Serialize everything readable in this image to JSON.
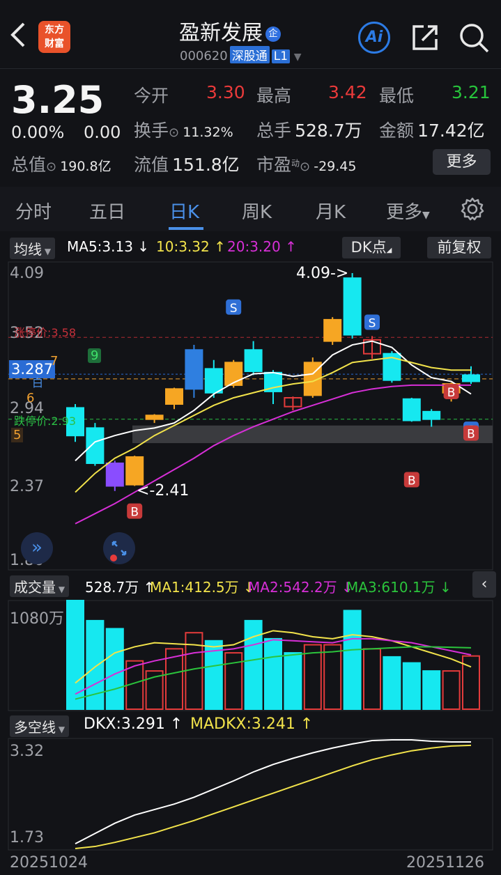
{
  "header": {
    "back_icon": "chevron-left-icon",
    "logo_line1": "东方",
    "logo_line2": "财富",
    "stock_name": "盈新发展",
    "company_badge": "企",
    "stock_code": "000620",
    "market_tag": "深股通",
    "level_tag": "L1",
    "ai_label": "Ai",
    "share_icon": "share-icon",
    "search_icon": "search-icon"
  },
  "quote": {
    "price": "3.25",
    "change_pct": "0.00%",
    "change": "0.00",
    "open_label": "今开",
    "open": "3.30",
    "high_label": "最高",
    "high": "3.42",
    "low_label": "最低",
    "low": "3.21",
    "turnover_label": "换手",
    "turnover": "11.32%",
    "volume_label": "总手",
    "volume": "528.7万",
    "amount_label": "金额",
    "amount": "17.42亿",
    "mktcap_label": "总值",
    "mktcap": "190.8亿",
    "float_label": "流值",
    "float_cap": "151.8亿",
    "pe_label": "市盈",
    "pe_sup": "动",
    "pe": "-29.45",
    "more_label": "更多",
    "colors": {
      "up": "#ea3a3a",
      "down": "#27c43c"
    }
  },
  "tabs": {
    "items": [
      "分时",
      "五日",
      "日K",
      "周K",
      "月K",
      "更多"
    ],
    "active": "日K",
    "settings_icon": "gear-icon"
  },
  "kline_toolbar": {
    "indicator": "均线",
    "ma5": "MA5:3.13 ↓",
    "ma10": "10:3.32 ↑",
    "ma20": "20:3.20 ↑",
    "dk_button": "DK点",
    "adjust_button": "前复权",
    "ma_colors": {
      "ma5": "#ffffff",
      "ma10": "#f2e34b",
      "ma20": "#d72fd7"
    }
  },
  "kline_chart": {
    "y_ticks": [
      "4.09",
      "3.52",
      "2.94",
      "2.37",
      "1.80"
    ],
    "high_annot": "4.09->",
    "low_annot": "<-2.41",
    "limit_up_label": "涨停价:3.58",
    "limit_down_label": "跌停价:2.93",
    "current_price_tag": "3.287",
    "dk_count_tags": [
      "7",
      "6",
      "5",
      "9"
    ],
    "dk_sell_label": "S",
    "dk_buy_label": "B",
    "partial_char": "白"
  },
  "chart_data": [
    {
      "type": "candlestick",
      "name": "日K",
      "x": [
        "20251024",
        "20251126"
      ],
      "ylim": [
        1.8,
        4.09
      ],
      "candles": [
        {
          "o": 2.8,
          "c": 3.02,
          "h": 3.05,
          "l": 2.75,
          "color": "cyan"
        },
        {
          "o": 2.86,
          "c": 2.58,
          "h": 2.9,
          "l": 2.56,
          "color": "cyan"
        },
        {
          "o": 2.4,
          "c": 2.58,
          "h": 2.6,
          "l": 2.36,
          "color": "purple"
        },
        {
          "o": 2.41,
          "c": 2.63,
          "h": 2.64,
          "l": 2.4,
          "color": "orange"
        },
        {
          "o": 2.93,
          "c": 2.96,
          "h": 2.97,
          "l": 2.9,
          "color": "orange"
        },
        {
          "o": 3.05,
          "c": 3.17,
          "h": 3.18,
          "l": 3.01,
          "color": "orange"
        },
        {
          "o": 3.17,
          "c": 3.48,
          "h": 3.52,
          "l": 3.1,
          "color": "blue"
        },
        {
          "o": 3.33,
          "c": 3.14,
          "h": 3.4,
          "l": 3.1,
          "color": "cyan"
        },
        {
          "o": 3.2,
          "c": 3.38,
          "h": 3.4,
          "l": 3.18,
          "color": "orange"
        },
        {
          "o": 3.48,
          "c": 3.31,
          "h": 3.55,
          "l": 3.28,
          "color": "cyan"
        },
        {
          "o": 3.3,
          "c": 3.15,
          "h": 3.32,
          "l": 3.05,
          "color": "cyan"
        },
        {
          "o": 3.1,
          "c": 3.03,
          "h": 3.11,
          "l": 3.0,
          "color": "red"
        },
        {
          "o": 3.12,
          "c": 3.38,
          "h": 3.42,
          "l": 3.1,
          "color": "orange"
        },
        {
          "o": 3.55,
          "c": 3.72,
          "h": 3.74,
          "l": 3.52,
          "color": "orange"
        },
        {
          "o": 3.6,
          "c": 4.05,
          "h": 4.09,
          "l": 3.57,
          "color": "cyan"
        },
        {
          "o": 3.56,
          "c": 3.45,
          "h": 3.59,
          "l": 3.41,
          "color": "red"
        },
        {
          "o": 3.45,
          "c": 3.24,
          "h": 3.47,
          "l": 3.22,
          "color": "cyan"
        },
        {
          "o": 3.09,
          "c": 2.92,
          "h": 3.1,
          "l": 2.91,
          "color": "cyan"
        },
        {
          "o": 2.99,
          "c": 2.93,
          "h": 3.01,
          "l": 2.87,
          "color": "cyan"
        },
        {
          "o": 3.21,
          "c": 3.14,
          "h": 3.22,
          "l": 3.07,
          "color": "orange"
        },
        {
          "o": 3.23,
          "c": 3.28,
          "h": 3.35,
          "l": 3.21,
          "color": "cyan"
        }
      ],
      "ma5": [
        2.6,
        2.75,
        2.8,
        2.84,
        2.86,
        2.9,
        3.0,
        3.13,
        3.22,
        3.29,
        3.3,
        3.27,
        3.29,
        3.44,
        3.52,
        3.55,
        3.5,
        3.36,
        3.26,
        3.23,
        3.13
      ],
      "ma10": [
        2.35,
        2.5,
        2.62,
        2.7,
        2.8,
        2.88,
        2.96,
        3.04,
        3.1,
        3.14,
        3.18,
        3.21,
        3.23,
        3.3,
        3.38,
        3.4,
        3.42,
        3.38,
        3.34,
        3.32,
        3.32
      ],
      "ma20": [
        2.1,
        2.18,
        2.26,
        2.35,
        2.44,
        2.53,
        2.62,
        2.72,
        2.8,
        2.87,
        2.93,
        2.99,
        3.04,
        3.09,
        3.14,
        3.17,
        3.19,
        3.2,
        3.2,
        3.2,
        3.2
      ]
    },
    {
      "type": "bar",
      "name": "成交量",
      "ylim": [
        0,
        1080
      ],
      "unit": "万",
      "values": [
        1080,
        880,
        800,
        480,
        380,
        600,
        760,
        680,
        560,
        880,
        700,
        560,
        640,
        640,
        980,
        600,
        520,
        460,
        380,
        380,
        528.7
      ],
      "colors": [
        "cyan",
        "cyan",
        "cyan",
        "red",
        "red",
        "red",
        "red",
        "cyan",
        "red",
        "cyan",
        "cyan",
        "cyan",
        "red",
        "red",
        "cyan",
        "red",
        "cyan",
        "cyan",
        "cyan",
        "red",
        "red"
      ],
      "ma1_label": "MA1:412.5万 ↓",
      "ma2_label": "MA2:542.2万 ↓",
      "ma3_label": "MA3:610.1万 ↓",
      "vol_label": "528.7万 ↑",
      "ma1": [
        260,
        420,
        560,
        620,
        660,
        650,
        640,
        620,
        640,
        720,
        780,
        760,
        720,
        700,
        740,
        720,
        680,
        620,
        560,
        500,
        420
      ],
      "ma2": [
        150,
        250,
        350,
        430,
        480,
        520,
        560,
        580,
        600,
        640,
        690,
        680,
        670,
        660,
        700,
        700,
        680,
        660,
        620,
        580,
        540
      ],
      "ma3": [
        100,
        150,
        200,
        260,
        320,
        360,
        400,
        430,
        460,
        490,
        520,
        540,
        560,
        570,
        590,
        600,
        610,
        620,
        620,
        615,
        610
      ]
    },
    {
      "type": "line",
      "name": "多空线",
      "ylim": [
        1.73,
        3.32
      ],
      "dkx_label": "DKX:3.291 ↑",
      "madkx_label": "MADKX:3.241 ↑",
      "dkx": [
        1.8,
        1.95,
        2.1,
        2.22,
        2.3,
        2.38,
        2.48,
        2.6,
        2.72,
        2.85,
        2.96,
        3.05,
        3.13,
        3.2,
        3.26,
        3.31,
        3.32,
        3.32,
        3.3,
        3.29,
        3.29
      ],
      "madkx": [
        1.73,
        1.76,
        1.82,
        1.89,
        1.96,
        2.05,
        2.14,
        2.24,
        2.34,
        2.44,
        2.54,
        2.64,
        2.74,
        2.84,
        2.94,
        3.03,
        3.1,
        3.16,
        3.2,
        3.23,
        3.24
      ]
    }
  ],
  "volume_toolbar": {
    "indicator": "成交量",
    "collapse_icon": "chevron-left-icon",
    "y_tick": "1080万"
  },
  "dkx_toolbar": {
    "indicator": "多空线",
    "y_ticks": [
      "3.32",
      "1.73"
    ]
  },
  "date_axis": {
    "start": "20251024",
    "end": "20251126"
  }
}
